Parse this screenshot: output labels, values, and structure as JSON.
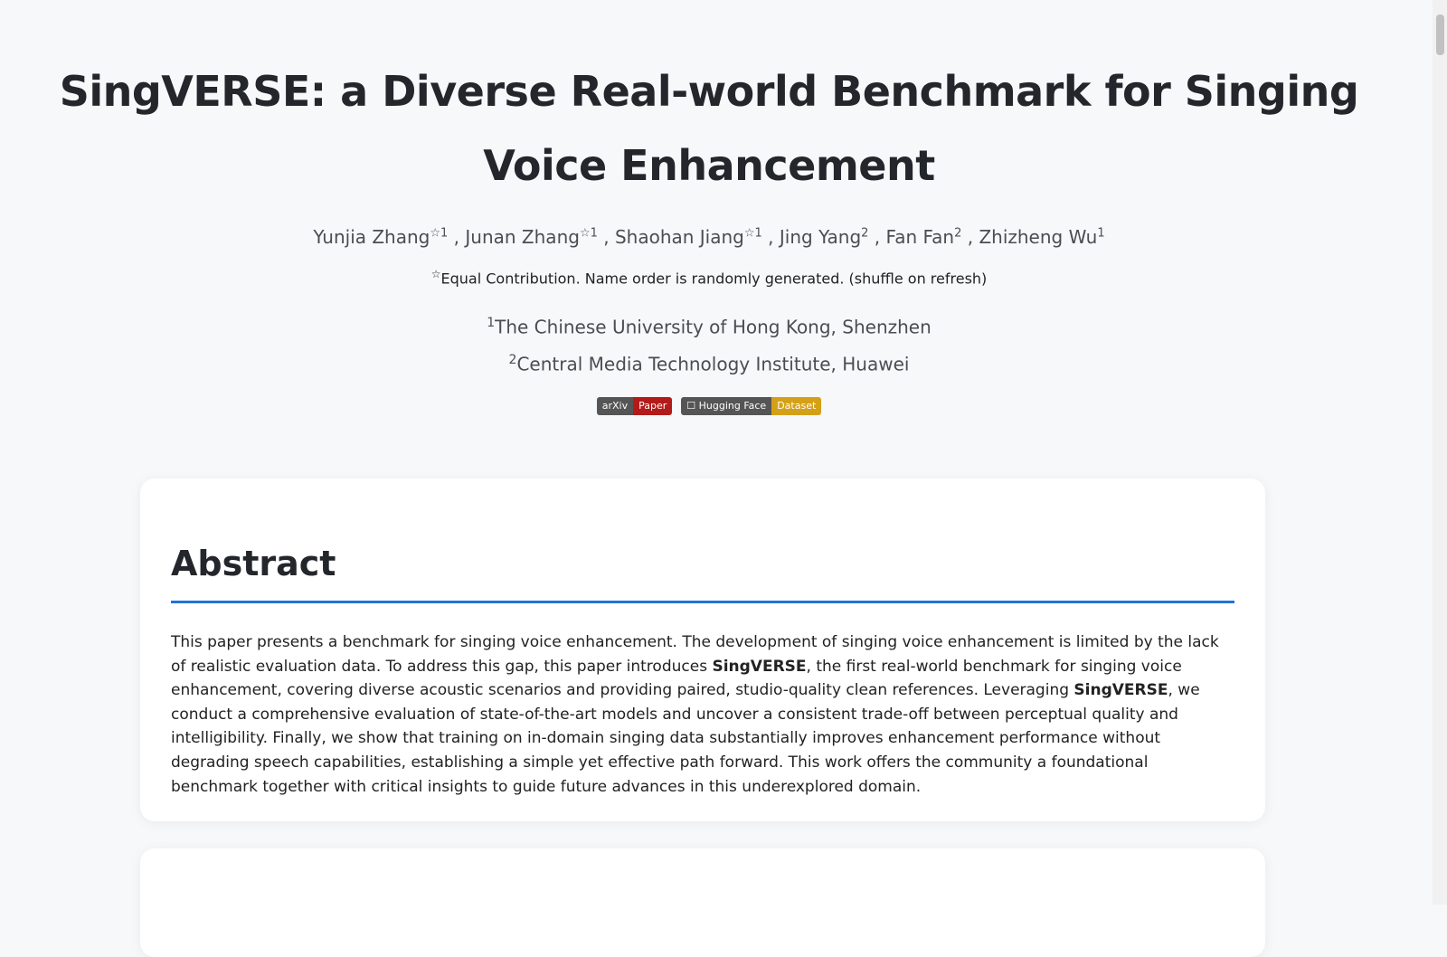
{
  "paper": {
    "title": "SingVERSE: a Diverse Real-world Benchmark for Singing Voice Enhancement",
    "authors": [
      {
        "name": "Yunjia Zhang",
        "mark": "☆1"
      },
      {
        "name": "Junan Zhang",
        "mark": "☆1"
      },
      {
        "name": "Shaohan Jiang",
        "mark": "☆1"
      },
      {
        "name": "Jing Yang",
        "mark": "2"
      },
      {
        "name": "Fan Fan",
        "mark": "2"
      },
      {
        "name": "Zhizheng Wu",
        "mark": "1"
      }
    ],
    "separator": " , ",
    "note_mark": "☆",
    "note": "Equal Contribution. Name order is randomly generated. (shuffle on refresh)",
    "affiliations": [
      {
        "mark": "1",
        "name": "The Chinese University of Hong Kong, Shenzhen"
      },
      {
        "mark": "2",
        "name": "Central Media Technology Institute, Huawei"
      }
    ]
  },
  "badges": {
    "arxiv": {
      "left": "arXiv",
      "right": "Paper"
    },
    "hf": {
      "left": "☐ Hugging Face",
      "right": "Dataset"
    }
  },
  "abstract": {
    "heading": "Abstract",
    "text_1": "This paper presents a benchmark for singing voice enhancement. The development of singing voice enhancement is limited by the lack of realistic evaluation data. To address this gap, this paper introduces ",
    "bold_1": "SingVERSE",
    "text_2": ", the first real-world benchmark for singing voice enhancement, covering diverse acoustic scenarios and providing paired, studio-quality clean references. Leveraging ",
    "bold_2": "SingVERSE",
    "text_3": ", we conduct a comprehensive evaluation of state-of-the-art models and uncover a consistent trade-off between perceptual quality and intelligibility. Finally, we show that training on in-domain singing data substantially improves enhancement performance without degrading speech capabilities, establishing a simple yet effective path forward. This work offers the community a foundational benchmark together with critical insights to guide future advances in this underexplored domain."
  },
  "colors": {
    "accent": "#1f74d8",
    "background": "#f7f8fa",
    "arxiv": "#b31b1b",
    "hf": "#d4a017"
  }
}
